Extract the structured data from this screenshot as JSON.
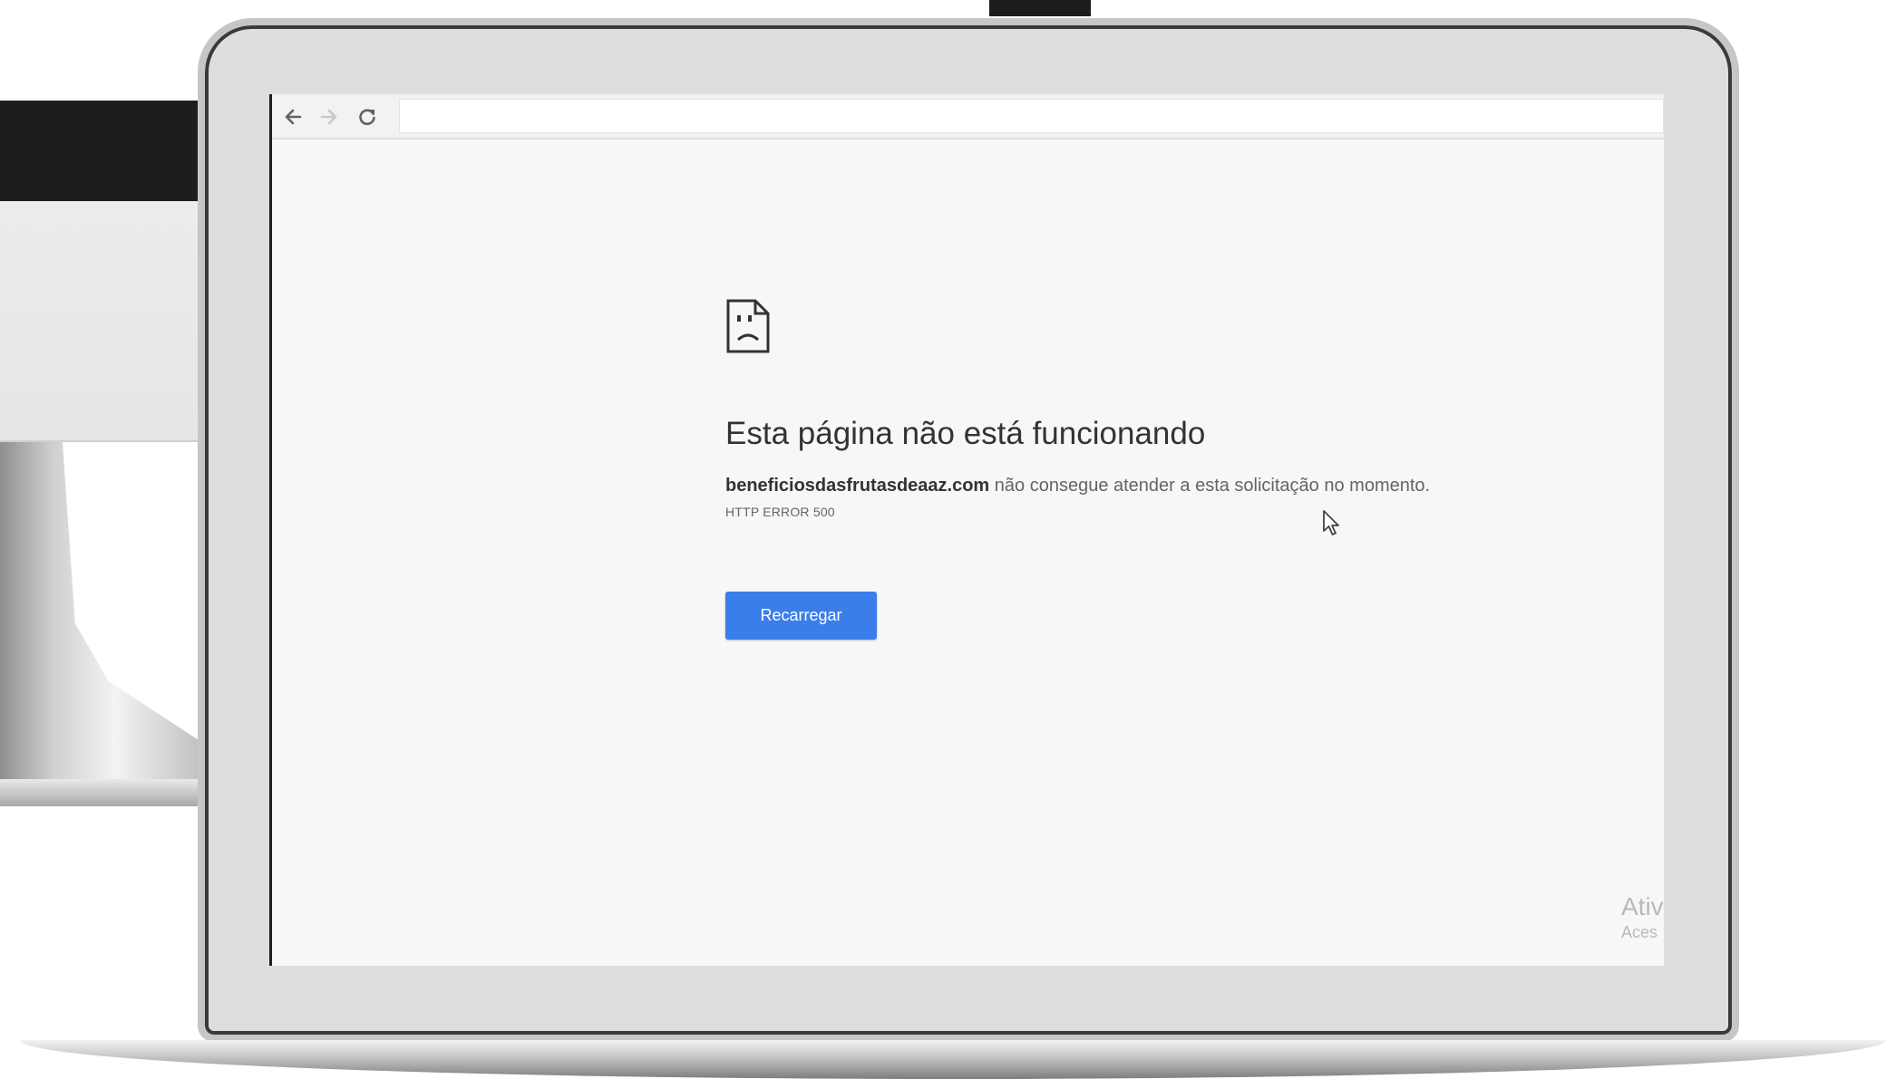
{
  "browser": {
    "address": "",
    "nav": {
      "back_icon": "arrow-back-icon",
      "forward_icon": "arrow-forward-icon",
      "reload_icon": "reload-icon"
    }
  },
  "error_page": {
    "icon": "sad-document-icon",
    "title": "Esta página não está funcionando",
    "domain": "beneficiosdasfrutasdeaaz.com",
    "message": " não consegue atender a esta solicitação no momento.",
    "code": "HTTP ERROR 500",
    "reload_label": "Recarregar"
  },
  "watermark": {
    "title": "Ativ",
    "subtitle": "Aces"
  },
  "colors": {
    "accent": "#3b7de9",
    "page_background": "#f7f7f7",
    "title_text": "#333333",
    "body_text": "#646464"
  }
}
